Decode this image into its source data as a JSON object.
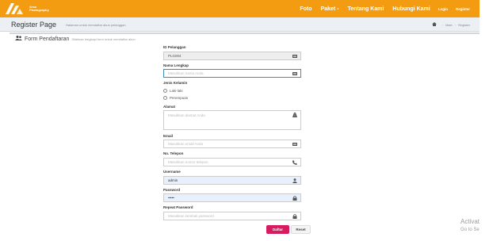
{
  "navbar": {
    "brand_text_1": "Arsa",
    "brand_text_2": "Photography",
    "items": [
      "Foto",
      "Paket -",
      "Tentang Kami",
      "Hubungi Kami"
    ],
    "auth": [
      "Login",
      "Register"
    ]
  },
  "header": {
    "title": "Register Page",
    "subtitle": "Halaman untuk mendaftar akun pelanggan",
    "breadcrumb": [
      "Main",
      "Register"
    ]
  },
  "form": {
    "title": "Form Pendaftaran",
    "description": "Silahkan lengkapi form untuk mendaftar akun",
    "id_label": "ID Pelanggan",
    "id_value": "PLG004",
    "name_label": "Nama Lengkap",
    "name_placeholder": "Masukkan nama Anda",
    "gender_label": "Jenis Kelamin",
    "gender_options": [
      "Laki-laki",
      "Perempuan"
    ],
    "address_label": "Alamat",
    "address_placeholder": "Masukkan alamat Anda",
    "email_label": "Email",
    "email_placeholder": "Masukkan email Anda",
    "phone_label": "No. Telepon",
    "phone_placeholder": "Masukkan nomor telepon",
    "username_label": "Username",
    "username_value": "admin",
    "password_label": "Password",
    "password_value": "•••••",
    "repeat_label": "Repeat Password",
    "repeat_placeholder": "Masukkan kembali password",
    "submit_label": "Daftar",
    "reset_label": "Reset"
  },
  "watermark": {
    "line1": "Activat",
    "line2": "Go to Se"
  },
  "colors": {
    "navbar": "#f39c12",
    "submit": "#d81b60",
    "focus": "#3c8dbc"
  }
}
